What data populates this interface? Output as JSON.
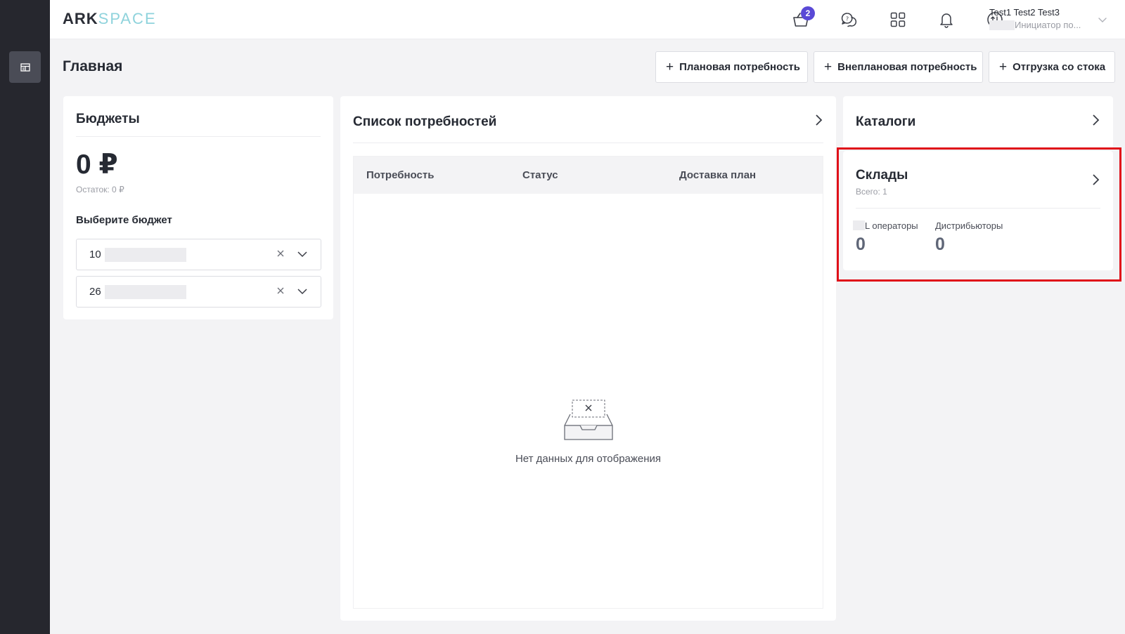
{
  "brand": {
    "logo_part1": "ARK",
    "logo_part2": "SPACE"
  },
  "header": {
    "cart_badge": "2",
    "user_name": "Test1 Test2 Test3",
    "user_role": "Инициатор по..."
  },
  "page": {
    "title": "Главная"
  },
  "actions": {
    "planned": "Плановая потребность",
    "unplanned": "Внеплановая потребность",
    "stock_shipment": "Отгрузка со стока"
  },
  "budgets": {
    "title": "Бюджеты",
    "amount": "0 ₽",
    "remaining": "Остаток: 0 ₽",
    "choose_label": "Выберите бюджет",
    "select1_value": "10",
    "select2_value": "26"
  },
  "needs": {
    "title": "Список потребностей",
    "columns": [
      "Потребность",
      "Статус",
      "Доставка план"
    ],
    "empty_text": "Нет данных для отображения"
  },
  "catalogs": {
    "title": "Каталоги"
  },
  "warehouses": {
    "title": "Склады",
    "total": "Всего: 1",
    "stats": [
      {
        "label": "L операторы",
        "value": "0"
      },
      {
        "label": "Дистрибьюторы",
        "value": "0"
      }
    ]
  },
  "colors": {
    "accent": "#5a49d6",
    "highlight": "#e01019",
    "sidebar": "#26272e"
  }
}
